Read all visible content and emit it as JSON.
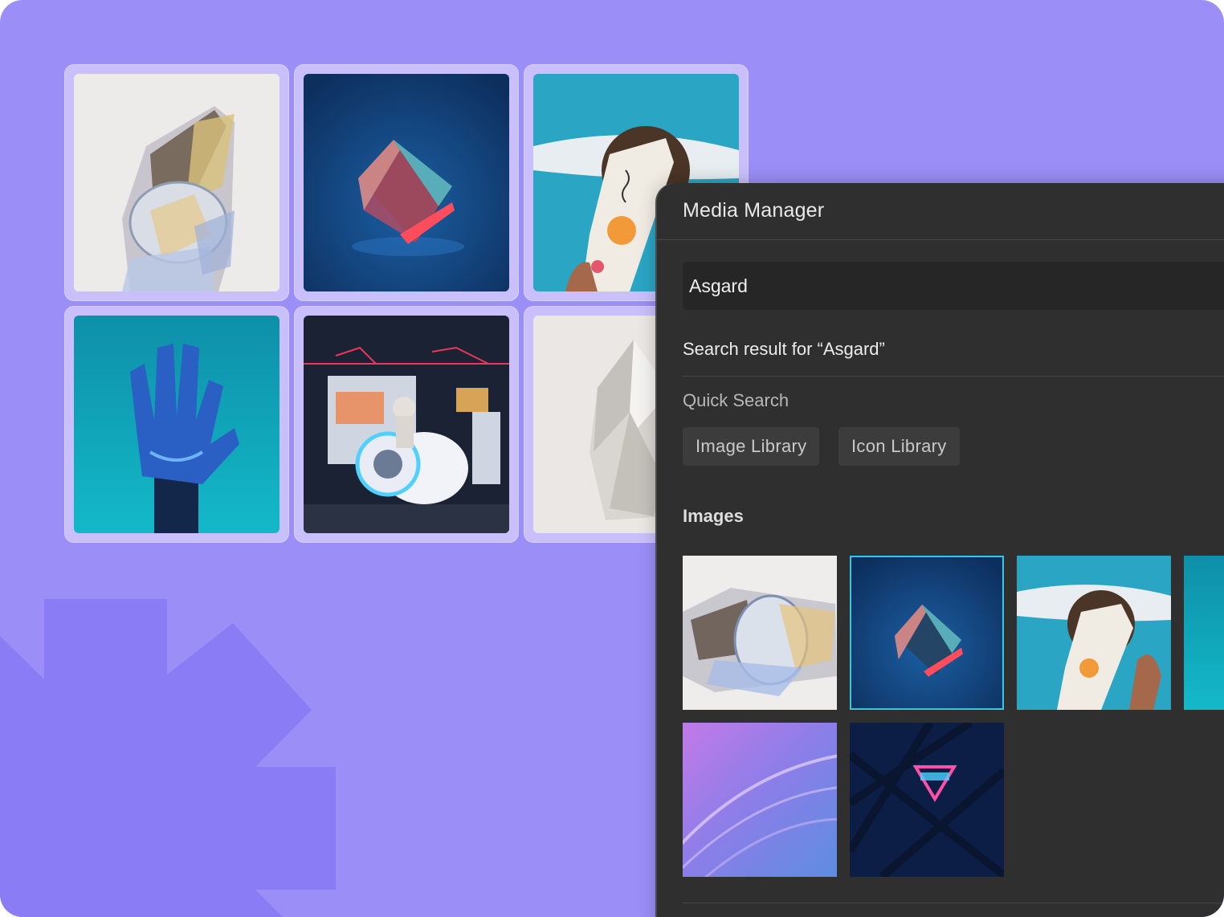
{
  "panel": {
    "title": "Media Manager",
    "search": {
      "value": "Asgard"
    },
    "result_label": "Search result for “Asgard”",
    "quick_search_label": "Quick Search",
    "chips": [
      "Image Library",
      "Icon Library"
    ],
    "images_label": "Images"
  },
  "colors": {
    "background": "#9b8ef6",
    "tile_frame": "#c9c0fb",
    "panel": "#2f2f2f",
    "selection": "#35c7e6"
  },
  "background_grid": [
    "prism-glass-photo",
    "crystal-cube-photo",
    "abstract-portrait-photo",
    "blue-robot-hand-photo",
    "vr-motorbike-photo",
    "quartz-crystal-photo"
  ],
  "results": [
    {
      "name": "prism-glass-thumb",
      "selected": false
    },
    {
      "name": "crystal-cube-thumb",
      "selected": true
    },
    {
      "name": "abstract-portrait-thumb",
      "selected": false
    },
    {
      "name": "teal-thumb",
      "selected": false
    },
    {
      "name": "purple-feather-thumb",
      "selected": false
    },
    {
      "name": "neon-club-sign-thumb",
      "selected": false
    }
  ]
}
